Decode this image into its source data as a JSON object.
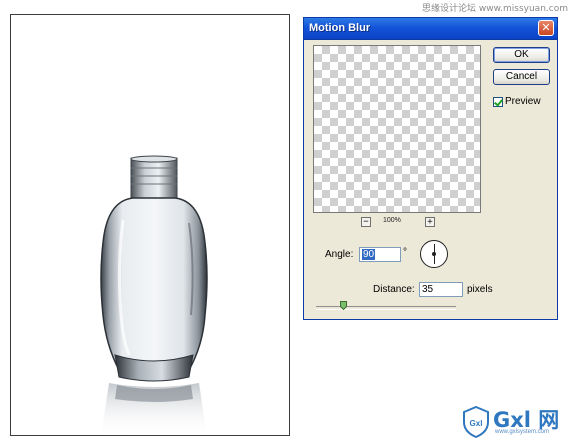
{
  "watermark_top": "思缘设计论坛 www.missyuan.com",
  "dialog": {
    "title": "Motion Blur",
    "close_glyph": "✕",
    "ok_label": "OK",
    "cancel_label": "Cancel",
    "preview_label": "Preview",
    "preview_checked": true,
    "zoom_out_glyph": "−",
    "zoom_in_glyph": "+",
    "zoom_level": "100%",
    "angle_label": "Angle:",
    "angle_value": "90",
    "angle_unit": "°",
    "distance_label": "Distance:",
    "distance_value": "35",
    "distance_unit": "pixels"
  },
  "logo": {
    "text": "Gxl 网",
    "badge_text": "Gxl",
    "url": "www.gxlsystem.com"
  },
  "icons": [
    "close-icon",
    "zoom-out-icon",
    "zoom-in-icon",
    "angle-dial-icon",
    "slider-thumb-icon",
    "shield-logo-icon"
  ],
  "colors": {
    "titlebar": "#1454d8",
    "dialog_bg": "#ece9d8",
    "close_button": "#c8461e",
    "selection": "#316ac5",
    "logo": "#2f78c0"
  }
}
